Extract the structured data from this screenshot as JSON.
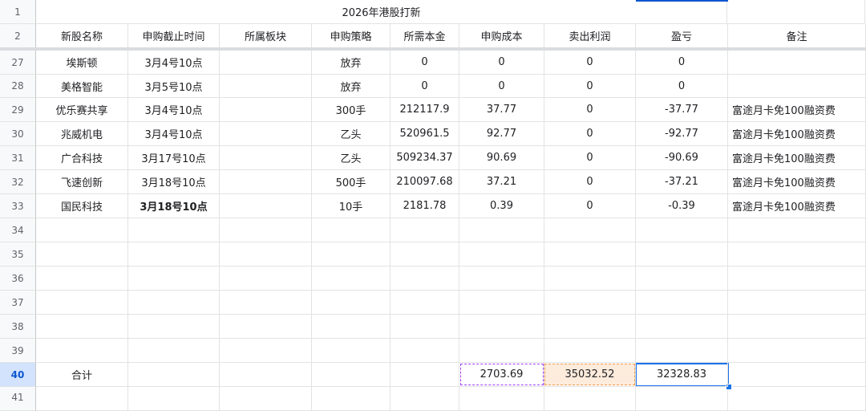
{
  "title": "2026年港股打新",
  "headers": [
    "新股名称",
    "申购截止时间",
    "所属板块",
    "申购策略",
    "所需本金",
    "申购成本",
    "卖出利润",
    "盈亏",
    "备注"
  ],
  "rows": [
    {
      "num": "27",
      "name": "埃斯顿",
      "deadline": "3月4号10点",
      "sector": "",
      "strategy": "放弃",
      "capital": "0",
      "cost": "0",
      "profit": "0",
      "pnl": "0",
      "note": ""
    },
    {
      "num": "28",
      "name": "美格智能",
      "deadline": "3月5号10点",
      "sector": "",
      "strategy": "放弃",
      "capital": "0",
      "cost": "0",
      "profit": "0",
      "pnl": "0",
      "note": ""
    },
    {
      "num": "29",
      "name": "优乐赛共享",
      "deadline": "3月4号10点",
      "sector": "",
      "strategy": "300手",
      "capital": "212117.9",
      "cost": "37.77",
      "profit": "0",
      "pnl": "-37.77",
      "note": "富途月卡免100融资费"
    },
    {
      "num": "30",
      "name": "兆威机电",
      "deadline": "3月4号10点",
      "sector": "",
      "strategy": "乙头",
      "capital": "520961.5",
      "cost": "92.77",
      "profit": "0",
      "pnl": "-92.77",
      "note": "富途月卡免100融资费"
    },
    {
      "num": "31",
      "name": "广合科技",
      "deadline": "3月17号10点",
      "sector": "",
      "strategy": "乙头",
      "capital": "509234.37",
      "cost": "90.69",
      "profit": "0",
      "pnl": "-90.69",
      "note": "富途月卡免100融资费"
    },
    {
      "num": "32",
      "name": "飞速创新",
      "deadline": "3月18号10点",
      "sector": "",
      "strategy": "500手",
      "capital": "210097.68",
      "cost": "37.21",
      "profit": "0",
      "pnl": "-37.21",
      "note": "富途月卡免100融资费"
    },
    {
      "num": "33",
      "name": "国民科技",
      "deadline": "3月18号10点",
      "sector": "",
      "strategy": "10手",
      "capital": "2181.78",
      "cost": "0.39",
      "profit": "0",
      "pnl": "-0.39",
      "note": "富途月卡免100融资费"
    }
  ],
  "empty_rows": [
    "34",
    "35",
    "36",
    "37",
    "38",
    "39"
  ],
  "total": {
    "num": "40",
    "label": "合计",
    "cost": "2703.69",
    "profit": "35032.52",
    "pnl": "32328.83"
  },
  "last_row_num": "41",
  "header_row_nums": [
    "1",
    "2"
  ],
  "colors": {
    "selection": "#1a73e8",
    "dash_purple": "#a142f4",
    "dash_orange": "#f29b4a",
    "orange_fill": "#fdebdc"
  }
}
